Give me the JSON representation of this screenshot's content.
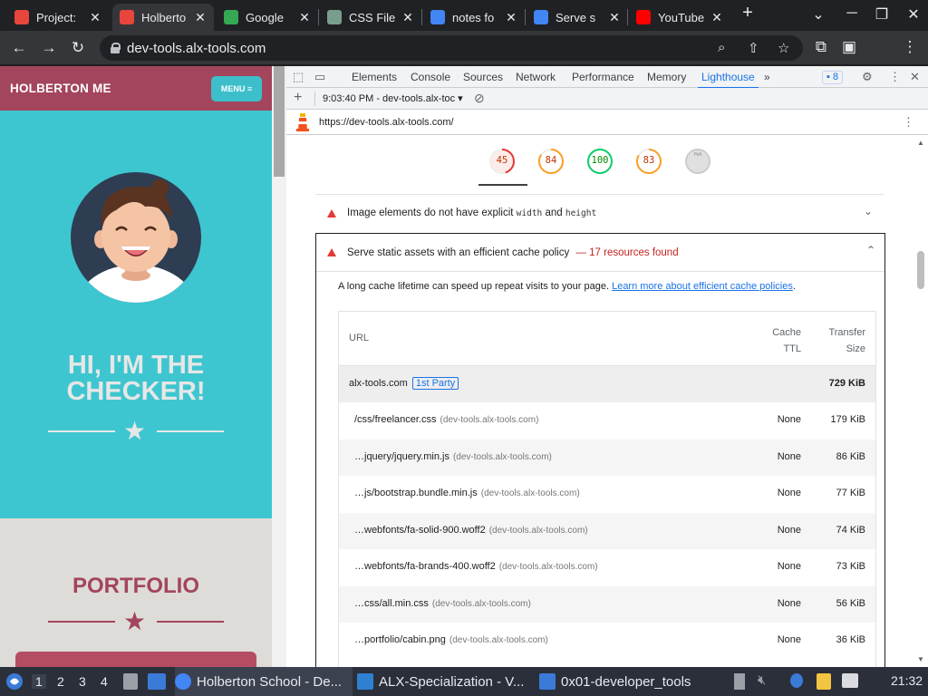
{
  "browser": {
    "tabs": [
      {
        "title": "Project:",
        "color": "#e8453c",
        "active": false
      },
      {
        "title": "Holberto",
        "color": "#e8453c",
        "active": true
      },
      {
        "title": "Google",
        "color": "#34a853",
        "active": false
      },
      {
        "title": "CSS File",
        "color": "#7a9e8e",
        "active": false
      },
      {
        "title": "notes fo",
        "color": "#4285f4",
        "active": false
      },
      {
        "title": "Serve s",
        "color": "#4285f4",
        "active": false
      },
      {
        "title": "YouTube",
        "color": "#ff0000",
        "active": false
      }
    ],
    "new_tab": "+",
    "url": "dev-tools.alx-tools.com"
  },
  "page": {
    "brand": "HOLBERTON ME",
    "menu_label": "MENU ≡",
    "hero_title": "HI, I'M THE CHECKER!",
    "portfolio_title": "PORTFOLIO"
  },
  "devtools": {
    "tabs": [
      "Elements",
      "Console",
      "Sources",
      "Network",
      "Performance",
      "Memory",
      "Lighthouse",
      "»"
    ],
    "selected_tab": "Lighthouse",
    "issues_count": "8",
    "report_select": "9:03:40 PM - dev-tools.alx-toc",
    "report_url": "https://dev-tools.alx-tools.com/",
    "gauges": [
      {
        "value": "45",
        "score": 0.45,
        "color": "#c33300",
        "ring": "#e53935",
        "bg": "#fdecea"
      },
      {
        "value": "84",
        "score": 0.84,
        "color": "#c33300",
        "ring": "#fa9f27",
        "bg": "#fff"
      },
      {
        "value": "100",
        "score": 1.0,
        "color": "#008800",
        "ring": "#0cce6b",
        "bg": "#fff"
      },
      {
        "value": "83",
        "score": 0.83,
        "color": "#c33300",
        "ring": "#fa9f27",
        "bg": "#fff"
      },
      {
        "value": "PWA",
        "score": 0,
        "color": "#999",
        "ring": "#ccc",
        "bg": "#e0e0e0"
      }
    ],
    "audit1": {
      "text": "Image elements do not have explicit ",
      "code1": "width",
      "and": " and ",
      "code2": "height"
    },
    "audit2": {
      "title": "Serve static assets with an efficient cache policy",
      "summary": "— 17 resources found"
    },
    "description": "A long cache lifetime can speed up repeat visits to your page. ",
    "learn_link": "Learn more about efficient cache policies",
    "table": {
      "col_url": "URL",
      "col_ttl_1": "Cache",
      "col_ttl_2": "TTL",
      "col_size_1": "Transfer",
      "col_size_2": "Size",
      "group": {
        "name": "alx-tools.com",
        "badge": "1st Party",
        "size": "729 KiB"
      },
      "rows": [
        {
          "url": "/css/freelancer.css",
          "domain": "(dev-tools.alx-tools.com)",
          "ttl": "None",
          "size": "179 KiB"
        },
        {
          "url": "…jquery/jquery.min.js",
          "domain": "(dev-tools.alx-tools.com)",
          "ttl": "None",
          "size": "86 KiB"
        },
        {
          "url": "…js/bootstrap.bundle.min.js",
          "domain": "(dev-tools.alx-tools.com)",
          "ttl": "None",
          "size": "77 KiB"
        },
        {
          "url": "…webfonts/fa-solid-900.woff2",
          "domain": "(dev-tools.alx-tools.com)",
          "ttl": "None",
          "size": "74 KiB"
        },
        {
          "url": "…webfonts/fa-brands-400.woff2",
          "domain": "(dev-tools.alx-tools.com)",
          "ttl": "None",
          "size": "73 KiB"
        },
        {
          "url": "…css/all.min.css",
          "domain": "(dev-tools.alx-tools.com)",
          "ttl": "None",
          "size": "56 KiB"
        },
        {
          "url": "…portfolio/cabin.png",
          "domain": "(dev-tools.alx-tools.com)",
          "ttl": "None",
          "size": "36 KiB"
        }
      ]
    }
  },
  "taskbar": {
    "workspaces": [
      "1",
      "2",
      "3",
      "4"
    ],
    "windows": [
      {
        "title": "Holberton School - De...",
        "color": "#4285f4"
      },
      {
        "title": "ALX-Specialization - V...",
        "color": "#2f80d1"
      },
      {
        "title": "0x01-developer_tools",
        "color": "#3b7bd8"
      }
    ],
    "clock": "21:32"
  }
}
